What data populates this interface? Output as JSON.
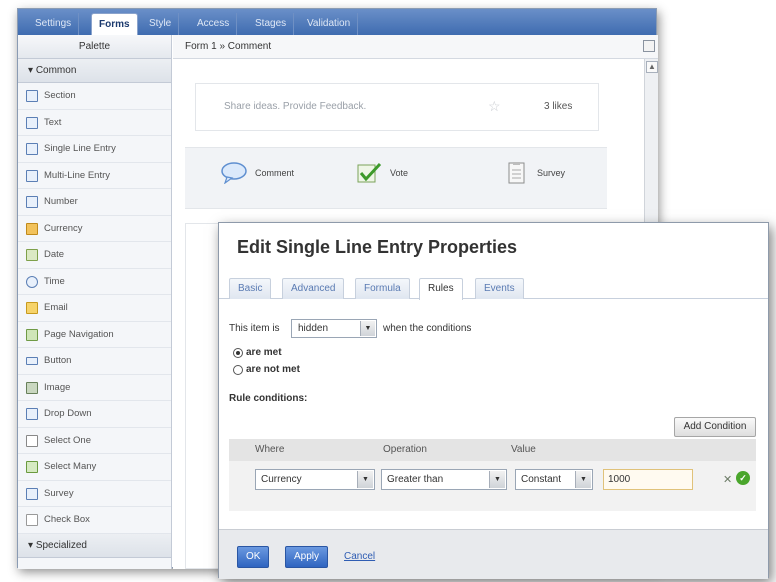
{
  "builder": {
    "tabs": [
      "Settings",
      "Forms",
      "Style",
      "Access",
      "Stages",
      "Validation"
    ],
    "palette_title": "Palette",
    "section_common": "Common",
    "items": [
      "Section",
      "Text",
      "Single Line Entry",
      "Multi-Line Entry",
      "Number",
      "Currency",
      "Date",
      "Time",
      "Email",
      "Page Navigation",
      "Button",
      "Image",
      "Drop Down",
      "Select One",
      "Select Many",
      "Survey",
      "Check Box"
    ],
    "section_specialized": "Specialized",
    "breadcrumb": "Form 1 » Comment",
    "share_text": "Share ideas. Provide Feedback.",
    "likes": "3 likes",
    "actions": [
      "Comment",
      "Vote",
      "Survey"
    ]
  },
  "dialog": {
    "title": "Edit Single Line Entry Properties",
    "tabs": [
      "Basic",
      "Advanced",
      "Formula",
      "Rules",
      "Events"
    ],
    "condition_prefix": "This item is",
    "state_value": "hidden",
    "condition_suffix": "when the conditions",
    "radio_met": "are met",
    "radio_not_met": "are not met",
    "rule_conditions_label": "Rule conditions:",
    "add_condition": "Add Condition",
    "table_headers": [
      "Where",
      "Operation",
      "Value"
    ],
    "row": {
      "where": "Currency",
      "operation": "Greater than",
      "value_type": "Constant",
      "value": "1000"
    },
    "ok": "OK",
    "apply": "Apply",
    "cancel": "Cancel"
  },
  "colors": {
    "topbar": "#3f6cb0",
    "button_blue": "#2f64c0",
    "check_green": "#4aa62c"
  }
}
